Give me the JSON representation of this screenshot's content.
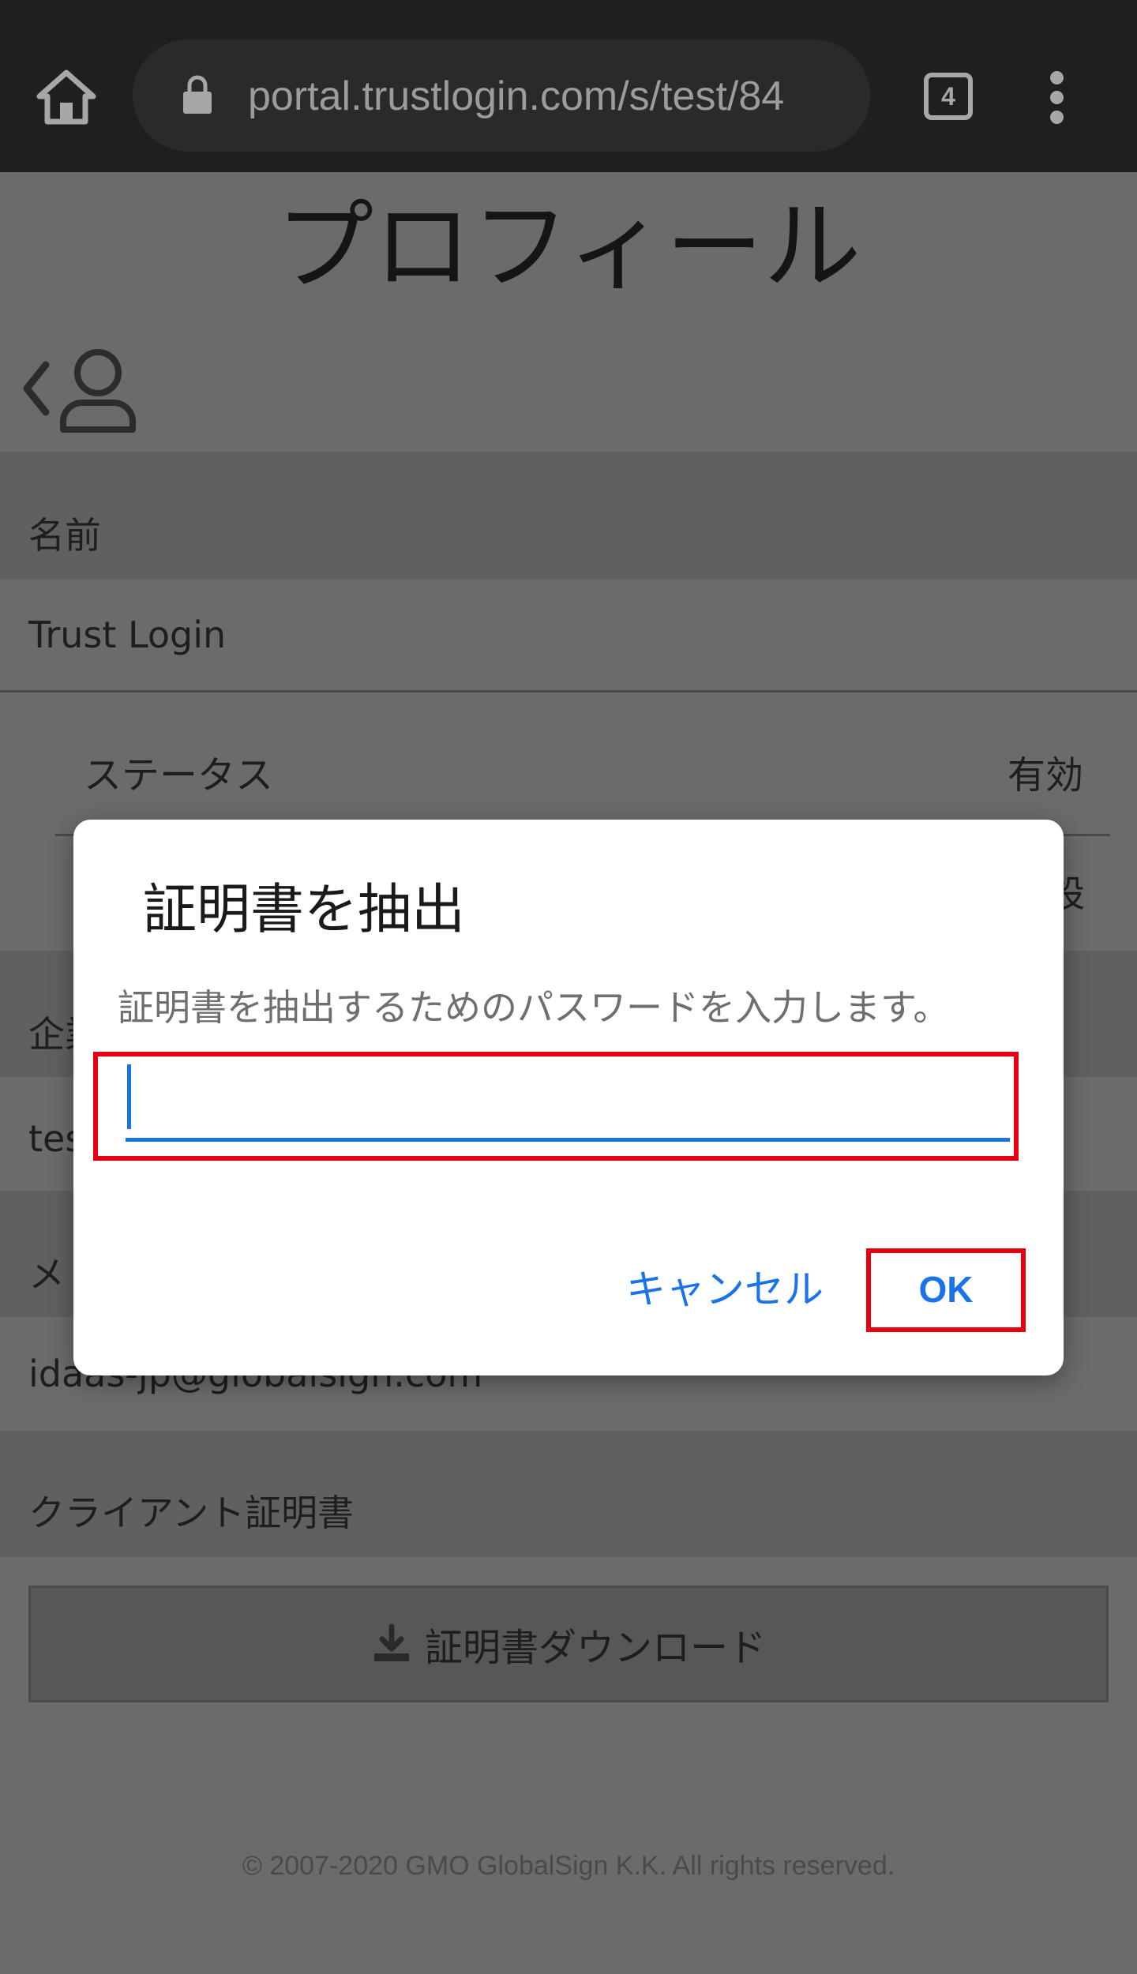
{
  "browser": {
    "url": "portal.trustlogin.com/s/test/84",
    "tab_count": "4",
    "icons": [
      "home-icon",
      "lock-icon",
      "tab-switcher-icon",
      "more-vert-icon"
    ]
  },
  "page": {
    "title": "プロフィール",
    "name_label": "名前",
    "name_value": "Trust Login",
    "status_label": "ステータス",
    "status_value": "有効",
    "setting_fragment": "設",
    "company_fragment": "企業",
    "company_value_fragment": "tes",
    "mail_fragment": "メ",
    "email_value": "idaas-jp@globalsign.com",
    "client_cert_label": "クライアント証明書",
    "download_label": "証明書ダウンロード",
    "footer": "© 2007-2020 GMO GlobalSign K.K. All rights reserved."
  },
  "dialog": {
    "title": "証明書を抽出",
    "message": "証明書を抽出するためのパスワードを入力します。",
    "password_value": "",
    "cancel_label": "キャンセル",
    "ok_label": "OK"
  },
  "colors": {
    "accent": "#1a73e8",
    "highlight": "#e60012",
    "scrim": "#6b6b6b",
    "toolbar": "#1f1f1f"
  }
}
